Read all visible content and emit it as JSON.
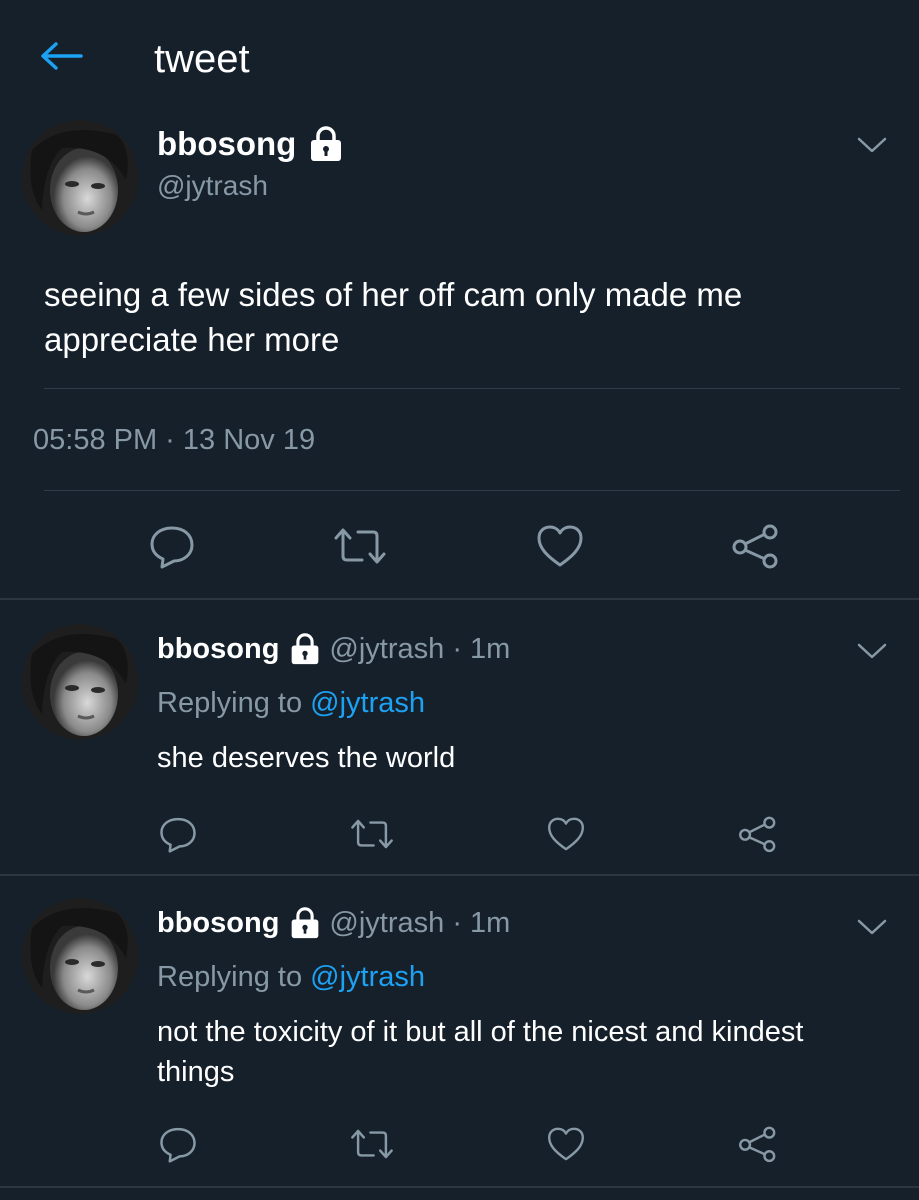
{
  "header": {
    "title": "tweet",
    "back_icon": "arrow-left-icon",
    "accent": "#1da1f2"
  },
  "main_tweet": {
    "display_name": "bbosong",
    "handle": "@jytrash",
    "text": "seeing a few sides of her off cam only made me appreciate her more",
    "timestamp": "05:58 PM · 13 Nov 19",
    "actions": [
      "reply-icon",
      "retweet-icon",
      "like-icon",
      "share-icon"
    ]
  },
  "replies": [
    {
      "display_name": "bbosong",
      "meta": "@jytrash · 1m",
      "replying_prefix": "Replying to",
      "replying_to": "@jytrash",
      "text": "she deserves the world"
    },
    {
      "display_name": "bbosong",
      "meta": "@jytrash · 1m",
      "replying_prefix": "Replying to",
      "replying_to": "@jytrash",
      "text": "not the toxicity of it but all of the nicest and kindest things"
    }
  ],
  "colors": {
    "background": "#15202b",
    "secondary_text": "#8899a6",
    "divider": "#2f3b47",
    "link": "#1da1f2"
  }
}
